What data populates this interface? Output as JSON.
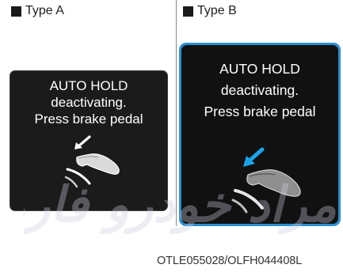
{
  "type_a": {
    "label": "Type A"
  },
  "type_b": {
    "label": "Type B"
  },
  "panel_a": {
    "line1": "AUTO HOLD",
    "line2": "deactivating.",
    "line3": "Press brake pedal",
    "arrow_color": "#ffffff"
  },
  "panel_b": {
    "line1": "AUTO HOLD",
    "line2": "deactivating.",
    "line3": "Press brake pedal",
    "arrow_color": "#1aa3e8",
    "border_color": "#2a8fd0"
  },
  "image_code": "OTLE055028/OLFH044408L",
  "watermark_text": "مراد خودرو فارما"
}
